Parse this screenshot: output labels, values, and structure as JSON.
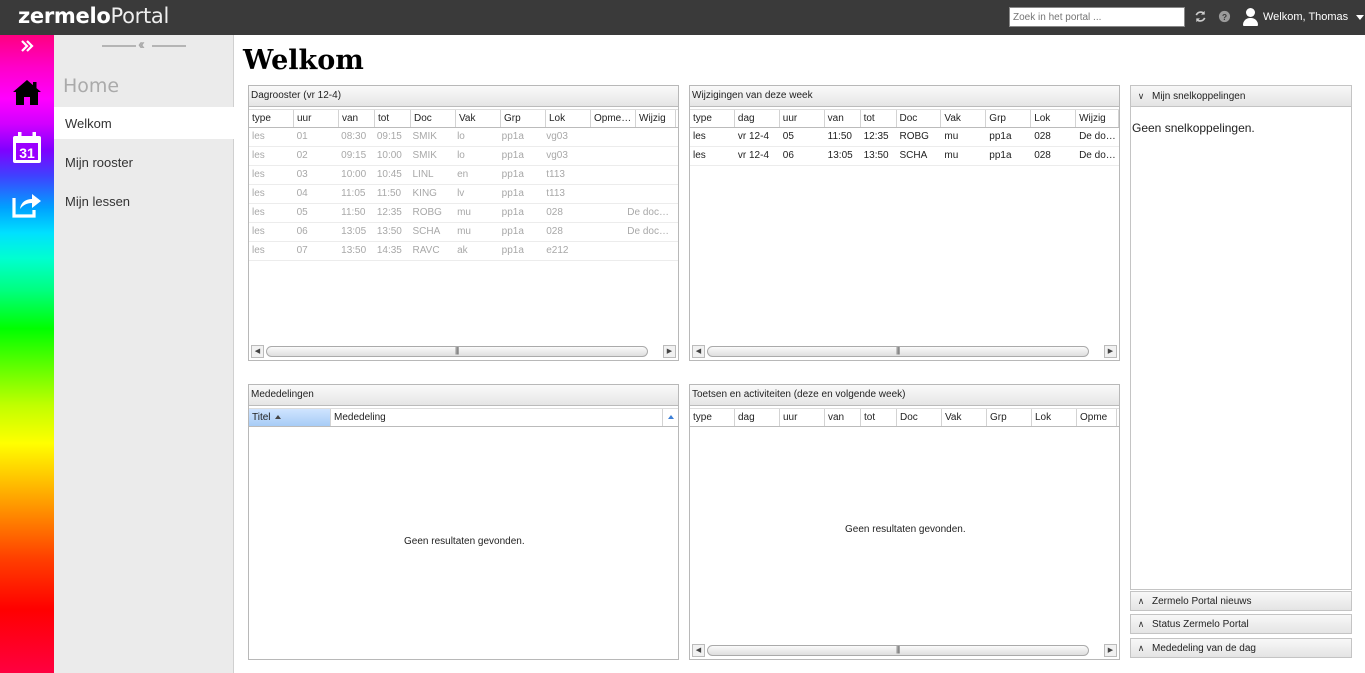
{
  "topbar": {
    "logo_bold": "zermelo",
    "logo_light": "Portal",
    "search_placeholder": "Zoek in het portal ...",
    "user_name": "Welkom, Thomas"
  },
  "nav": {
    "heading": "Home",
    "items": [
      {
        "label": "Welkom",
        "active": true
      },
      {
        "label": "Mijn rooster",
        "active": false
      },
      {
        "label": "Mijn lessen",
        "active": false
      }
    ]
  },
  "icons": {
    "expand": "double-chevron-right-icon",
    "home": "home-icon",
    "calendar": "calendar-icon",
    "share": "share-icon",
    "calendar_day": "31",
    "refresh": "refresh-icon",
    "help": "help-icon",
    "user": "user-icon"
  },
  "page_title": "Welkom",
  "dagrooster": {
    "title": "Dagrooster (vr 12-4)",
    "columns": [
      "type",
      "uur",
      "van",
      "tot",
      "Doc",
      "Vak",
      "Grp",
      "Lok",
      "Opme…",
      "Wijzig"
    ],
    "rows": [
      [
        "les",
        "01",
        "08:30",
        "09:15",
        "SMIK",
        "lo",
        "pp1a",
        "vg03",
        "",
        ""
      ],
      [
        "les",
        "02",
        "09:15",
        "10:00",
        "SMIK",
        "lo",
        "pp1a",
        "vg03",
        "",
        ""
      ],
      [
        "les",
        "03",
        "10:00",
        "10:45",
        "LINL",
        "en",
        "pp1a",
        "t113",
        "",
        ""
      ],
      [
        "les",
        "04",
        "11:05",
        "11:50",
        "KING",
        "lv",
        "pp1a",
        "t113",
        "",
        ""
      ],
      [
        "les",
        "05",
        "11:50",
        "12:35",
        "ROBG",
        "mu",
        "pp1a",
        "028",
        "",
        "De doc…"
      ],
      [
        "les",
        "06",
        "13:05",
        "13:50",
        "SCHA",
        "mu",
        "pp1a",
        "028",
        "",
        "De doc…"
      ],
      [
        "les",
        "07",
        "13:50",
        "14:35",
        "RAVC",
        "ak",
        "pp1a",
        "e212",
        "",
        ""
      ]
    ]
  },
  "wijzigingen": {
    "title": "Wijzigingen van deze week",
    "columns": [
      "type",
      "dag",
      "uur",
      "van",
      "tot",
      "Doc",
      "Vak",
      "Grp",
      "Lok",
      "Wijzig"
    ],
    "rows": [
      [
        "les",
        "vr 12-4",
        "05",
        "11:50",
        "12:35",
        "ROBG",
        "mu",
        "pp1a",
        "028",
        "De doc…"
      ],
      [
        "les",
        "vr 12-4",
        "06",
        "13:05",
        "13:50",
        "SCHA",
        "mu",
        "pp1a",
        "028",
        "De doc…"
      ]
    ]
  },
  "mededelingen": {
    "title": "Mededelingen",
    "columns": [
      "Titel",
      "Mededeling"
    ],
    "empty": "Geen resultaten gevonden."
  },
  "toetsen": {
    "title": "Toetsen en activiteiten (deze en volgende week)",
    "columns": [
      "type",
      "dag",
      "uur",
      "van",
      "tot",
      "Doc",
      "Vak",
      "Grp",
      "Lok",
      "Opme"
    ],
    "empty": "Geen resultaten gevonden."
  },
  "right": {
    "snel_title": "Mijn snelkoppelingen",
    "snel_empty": "Geen snelkoppelingen.",
    "sections": [
      "Zermelo Portal nieuws",
      "Status Zermelo Portal",
      "Mededeling van de dag"
    ]
  },
  "colors": {
    "topbar": "#3a3a3a",
    "sorted_header": "#a7ccf6"
  }
}
